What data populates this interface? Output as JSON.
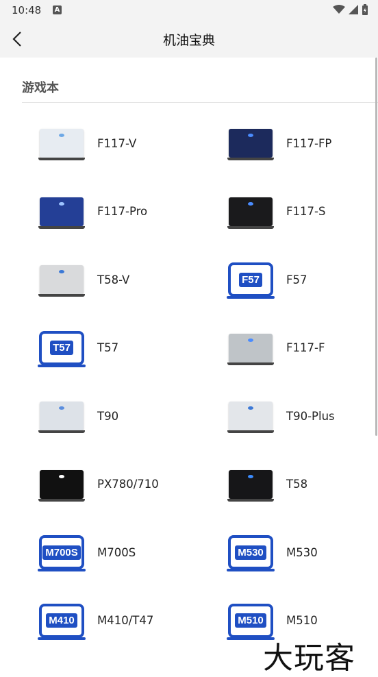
{
  "status": {
    "time": "10:48"
  },
  "header": {
    "title": "机油宝典"
  },
  "section": {
    "title": "游戏本"
  },
  "items": [
    {
      "label": "F117-V",
      "thumb": "laptop",
      "color": "#e7ecf2",
      "accent": "#6ea8e6"
    },
    {
      "label": "F117-FP",
      "thumb": "laptop",
      "color": "#1c2a5c",
      "accent": "#4a8cff"
    },
    {
      "label": "F117-Pro",
      "thumb": "laptop",
      "color": "#243f96",
      "accent": "#9ec4ff"
    },
    {
      "label": "F117-S",
      "thumb": "laptop",
      "color": "#1a1a1c",
      "accent": "#4a8cff"
    },
    {
      "label": "T58-V",
      "thumb": "laptop",
      "color": "#d9dadc",
      "accent": "#3b78d6"
    },
    {
      "label": "F57",
      "thumb": "badge"
    },
    {
      "label": "T57",
      "thumb": "badge"
    },
    {
      "label": "F117-F",
      "thumb": "laptop",
      "color": "#bfc4c8",
      "accent": "#4a8cff"
    },
    {
      "label": "T90",
      "thumb": "laptop",
      "color": "#dde2e8",
      "accent": "#5b8ede"
    },
    {
      "label": "T90-Plus",
      "thumb": "laptop",
      "color": "#e3e6ea",
      "accent": "#3b78d6"
    },
    {
      "label": "PX780/710",
      "thumb": "laptop",
      "color": "#111111",
      "accent": "#ffffff"
    },
    {
      "label": "T58",
      "thumb": "laptop",
      "color": "#161618",
      "accent": "#3b8cff"
    },
    {
      "label": "M700S",
      "thumb": "badge"
    },
    {
      "label": "M530",
      "thumb": "badge"
    },
    {
      "label": "M410/T47",
      "thumb": "badge",
      "badge_text": "M410"
    },
    {
      "label": "M510",
      "thumb": "badge"
    }
  ],
  "watermark": {
    "text": "大玩客"
  }
}
